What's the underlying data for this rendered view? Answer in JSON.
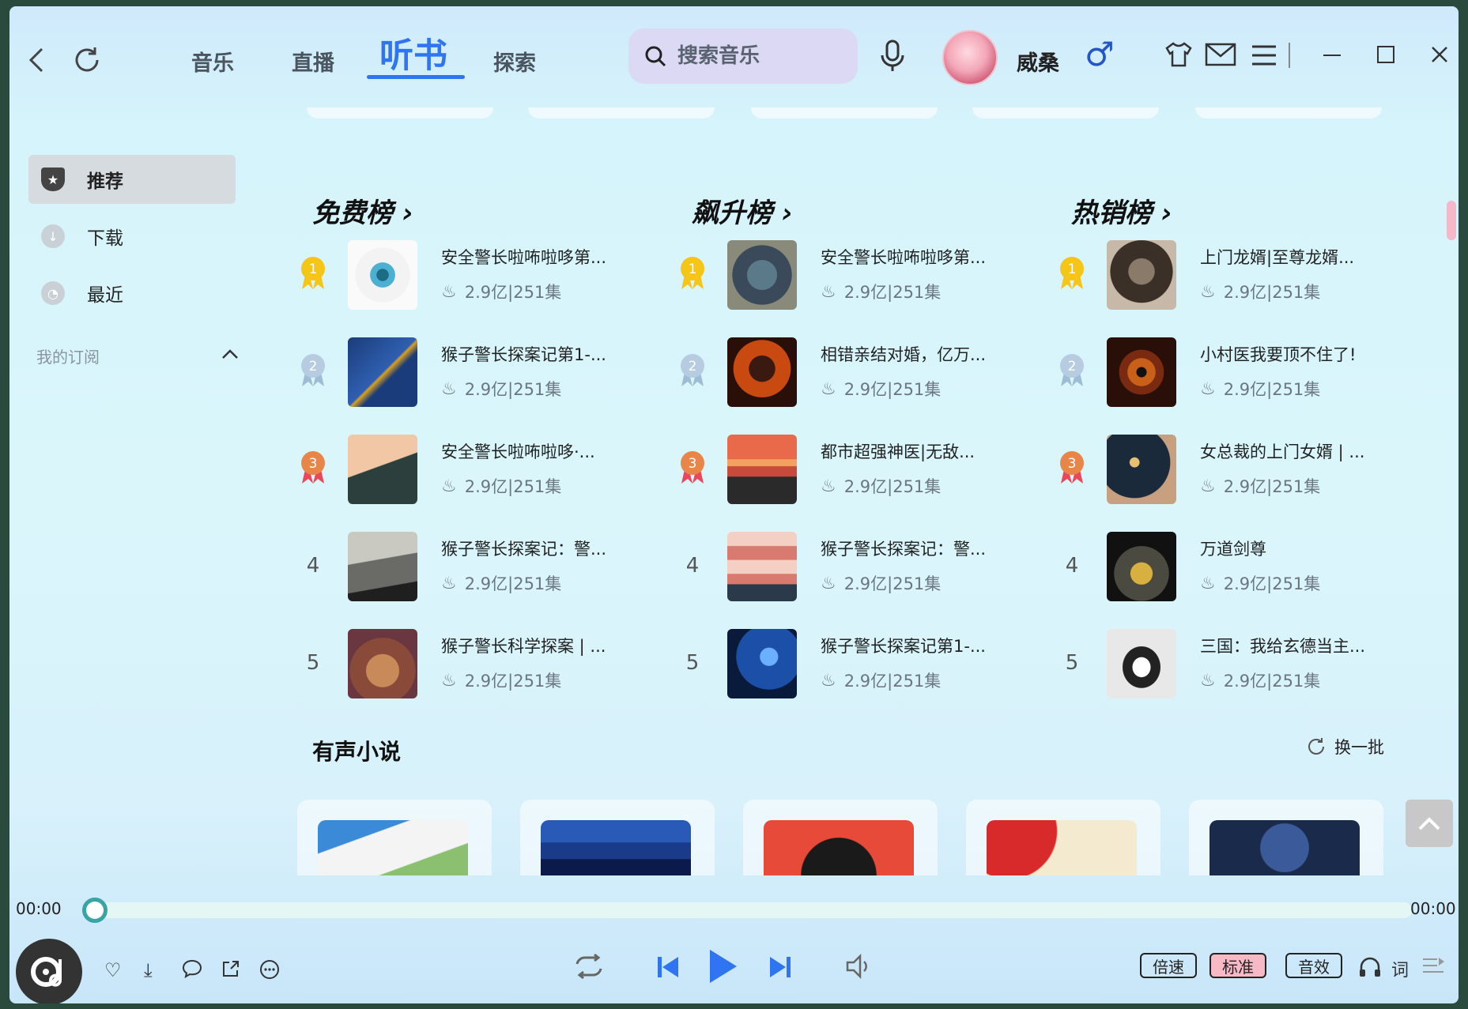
{
  "header": {
    "tabs": [
      {
        "label": "音乐",
        "active": false
      },
      {
        "label": "直播",
        "active": false
      },
      {
        "label": "听书",
        "active": true
      },
      {
        "label": "探索",
        "active": false
      }
    ],
    "search_placeholder": "搜索音乐",
    "username": "威桑",
    "gender_symbol": "♂"
  },
  "sidebar": {
    "items": [
      {
        "label": "推荐",
        "active": true
      },
      {
        "label": "下载",
        "active": false
      },
      {
        "label": "最近",
        "active": false
      }
    ],
    "subscriptions_label": "我的订阅"
  },
  "rankings": [
    {
      "title": "免费榜 ›",
      "items": [
        {
          "rank": "1",
          "title": "安全警长啦咘啦哆第...",
          "meta": "2.9亿|251集"
        },
        {
          "rank": "2",
          "title": "猴子警长探案记第1-...",
          "meta": "2.9亿|251集"
        },
        {
          "rank": "3",
          "title": "安全警长啦咘啦哆·...",
          "meta": "2.9亿|251集"
        },
        {
          "rank": "4",
          "title": "猴子警长探案记：警...",
          "meta": "2.9亿|251集"
        },
        {
          "rank": "5",
          "title": "猴子警长科学探案 | ...",
          "meta": "2.9亿|251集"
        }
      ]
    },
    {
      "title": "飙升榜 ›",
      "items": [
        {
          "rank": "1",
          "title": "安全警长啦咘啦哆第...",
          "meta": "2.9亿|251集"
        },
        {
          "rank": "2",
          "title": "相错亲结对婚，亿万...",
          "meta": "2.9亿|251集"
        },
        {
          "rank": "3",
          "title": "都市超强神医|无敌...",
          "meta": "2.9亿|251集"
        },
        {
          "rank": "4",
          "title": "猴子警长探案记：警...",
          "meta": "2.9亿|251集"
        },
        {
          "rank": "5",
          "title": "猴子警长探案记第1-...",
          "meta": "2.9亿|251集"
        }
      ]
    },
    {
      "title": "热销榜 ›",
      "items": [
        {
          "rank": "1",
          "title": "上门龙婿|至尊龙婿...",
          "meta": "2.9亿|251集"
        },
        {
          "rank": "2",
          "title": "小村医我要顶不住了!",
          "meta": "2.9亿|251集"
        },
        {
          "rank": "3",
          "title": "女总裁的上门女婿 | ...",
          "meta": "2.9亿|251集"
        },
        {
          "rank": "4",
          "title": "万道剑尊",
          "meta": "2.9亿|251集"
        },
        {
          "rank": "5",
          "title": "三国：我给玄德当主...",
          "meta": "2.9亿|251集"
        }
      ]
    }
  ],
  "section": {
    "title": "有声小说",
    "refresh_label": "换一批"
  },
  "player": {
    "current_time": "00:00",
    "total_time": "00:00",
    "progress": 0,
    "speed_label": "倍速",
    "quality_label": "标准",
    "effect_label": "音效",
    "lyrics_label": "词"
  },
  "colors": {
    "accent": "#2f74f0",
    "progress": "#59c4c4",
    "quality_pill": "#f7b9c5",
    "gold": "#f5c518",
    "silver": "#9fbcd6",
    "bronze": "#e8864a"
  }
}
